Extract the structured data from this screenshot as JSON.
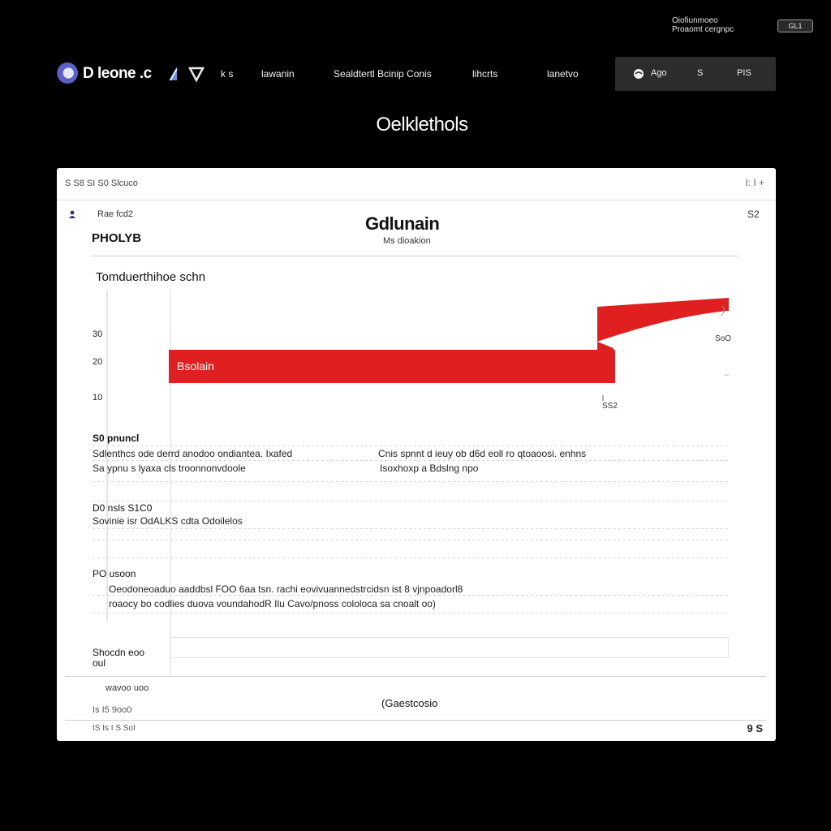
{
  "top_right": {
    "line1": "Oiofiunmoeo",
    "line2": "Proaomt cergnpc",
    "badge": "GL1"
  },
  "nav": {
    "brand": "D leone .c",
    "icon_glyph": "∆ ∇",
    "items": [
      {
        "label": "k  s"
      },
      {
        "label": "lawanin"
      },
      {
        "label": "Sealdtertl Bcinip Conis"
      },
      {
        "label": "lihcrts"
      },
      {
        "label": "lanetvo"
      }
    ],
    "box_items": [
      {
        "label": "Ago"
      },
      {
        "label": "S"
      },
      {
        "label": "PIS"
      }
    ]
  },
  "page_heading": "Oelklethols",
  "card": {
    "top_left": "S S8  SI S0  Slcuco",
    "top_right": "I:  I  +",
    "sub_left": "Rae fcd2",
    "sub_right": "S2",
    "panel_title": "Gdlunain",
    "panel_subtitle": "Ms dioakion",
    "side_label": "PHOLYB",
    "section_heading": "Tomduerthihoe schn",
    "chart_data": {
      "type": "bar",
      "y_ticks": [
        "30",
        "20",
        "10"
      ],
      "bar_label": "Bsolain",
      "callout_left": "SS2",
      "callout_right": "SoO",
      "red_color": "#e02020"
    },
    "rows": [
      {
        "label": "S0 pnuncl",
        "col1_line1": "Sdlenthcs ode derrd anodoo ondiantea.  Ixafed",
        "col1_line2": "Sa ypnu s lyaxa cls troonnonvdoole",
        "col2_line1": "Cnis spnnt d ieuy ob d6d eoll ro qtoaoosi. enhns",
        "col2_line2": "Isoxhoxp a Bdslng npo"
      },
      {
        "label": "D0  nsls  S1C0",
        "col1_line1": "Sovinie isr  OdALKS cdta  Odoilelos"
      },
      {
        "label": "PO usoon",
        "col1_line1": "Oeodoneoaduo aaddbsl FOO 6aa tsn. rachi eovivuannedstrcidsn ist 8 vjnpoadorl8",
        "col1_line2": "roaocy bo codlies duova  voundahodR Ilu  Cavo/pnoss cololoca sa cnoalt oo)"
      },
      {
        "label": "Shocdn eoo",
        "label2": "oul"
      }
    ],
    "footer": {
      "left1": "wavoo  uoo",
      "left2": "Is  I5 9oo0",
      "bottom_left": "IS Is I S  SoI",
      "center": "(Gaestcosio",
      "right": "9  S"
    }
  }
}
